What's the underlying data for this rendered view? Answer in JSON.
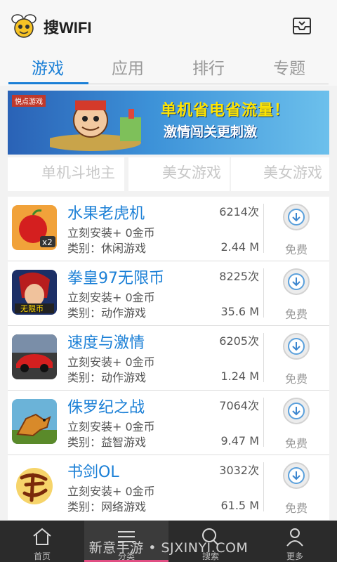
{
  "app": {
    "title": "搜WIFI",
    "logo_icon": "bee-logo-icon",
    "inbox_icon": "inbox-tray-icon"
  },
  "tabs": [
    {
      "label": "游戏",
      "active": true
    },
    {
      "label": "应用",
      "active": false
    },
    {
      "label": "排行",
      "active": false
    },
    {
      "label": "专题",
      "active": false
    }
  ],
  "banner": {
    "brand": "悦点游戏",
    "title": "单机省电省流量！",
    "subtitle": "激情闯关更刺激"
  },
  "categories": [
    "单机斗地主",
    "美女游戏",
    "美女游戏"
  ],
  "apps": [
    {
      "name": "水果老虎机",
      "reward": "立刻安装+ 0金币",
      "category": "类别：休闲游戏",
      "count": "6214次",
      "size": "2.44 M",
      "price": "免费",
      "icon": "apple-slot-icon"
    },
    {
      "name": "拳皇97无限币",
      "reward": "立刻安装+ 0金币",
      "category": "类别：动作游戏",
      "count": "8225次",
      "size": "35.6 M",
      "price": "免费",
      "icon": "fighter-icon"
    },
    {
      "name": "速度与激情",
      "reward": "立刻安装+ 0金币",
      "category": "类别：动作游戏",
      "count": "6205次",
      "size": "1.24 M",
      "price": "免费",
      "icon": "red-car-icon"
    },
    {
      "name": "侏罗纪之战",
      "reward": "立刻安装+ 0金币",
      "category": "类别：益智游戏",
      "count": "7064次",
      "size": "9.47 M",
      "price": "免费",
      "icon": "dinosaur-icon"
    },
    {
      "name": "书剑OL",
      "reward": "立刻安装+ 0金币",
      "category": "类别：网络游戏",
      "count": "3032次",
      "size": "61.5 M",
      "price": "免费",
      "icon": "calligraphy-icon"
    }
  ],
  "bottom_nav": [
    {
      "label": "首页",
      "icon": "home-icon",
      "active": false
    },
    {
      "label": "分类",
      "icon": "menu-icon",
      "active": true
    },
    {
      "label": "搜索",
      "icon": "search-icon",
      "active": false
    },
    {
      "label": "更多",
      "icon": "user-icon",
      "active": false
    }
  ],
  "watermark": "新意手游 • SJXINYI.COM",
  "colors": {
    "accent": "#1a7fd6",
    "nav_bg": "#2b2b2b",
    "nav_active_bar": "#e04e82"
  }
}
